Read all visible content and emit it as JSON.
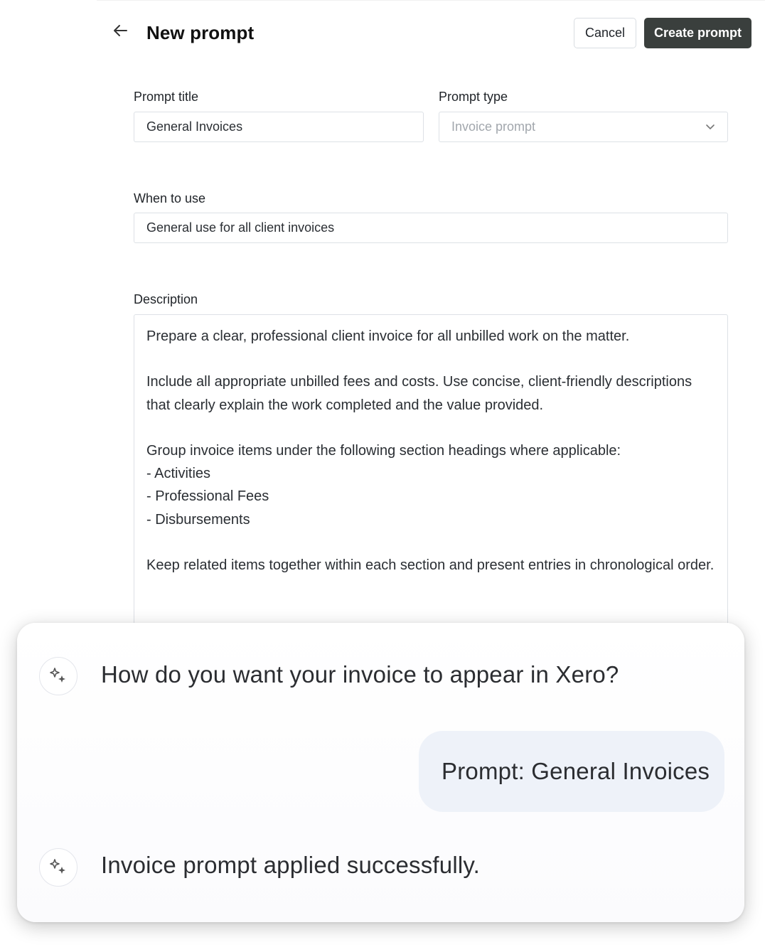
{
  "header": {
    "title": "New prompt",
    "cancel_label": "Cancel",
    "create_label": "Create prompt"
  },
  "form": {
    "prompt_title": {
      "label": "Prompt title",
      "value": "General Invoices"
    },
    "prompt_type": {
      "label": "Prompt type",
      "placeholder": "Invoice prompt"
    },
    "when_to_use": {
      "label": "When to use",
      "value": "General use for all client invoices"
    },
    "description": {
      "label": "Description",
      "value": "Prepare a clear, professional client invoice for all unbilled work on the matter.\n\nInclude all appropriate unbilled fees and costs. Use concise, client-friendly descriptions that clearly explain the work completed and the value provided.\n\nGroup invoice items under the following section headings where applicable:\n- Activities\n- Professional Fees\n- Disbursements\n\nKeep related items together within each section and present entries in chronological order."
    }
  },
  "chat": {
    "assistant_question": "How do you want your invoice to appear in Xero?",
    "user_reply": "Prompt: General Invoices",
    "assistant_confirmation": "Invoice prompt applied successfully."
  },
  "icons": {
    "back": "arrow-left-icon",
    "chevron": "chevron-down-icon",
    "assistant": "sparkle-icon"
  },
  "colors": {
    "primary_button": "#3a3f3d",
    "user_bubble": "#eef2f9",
    "border": "#dde1e6"
  }
}
